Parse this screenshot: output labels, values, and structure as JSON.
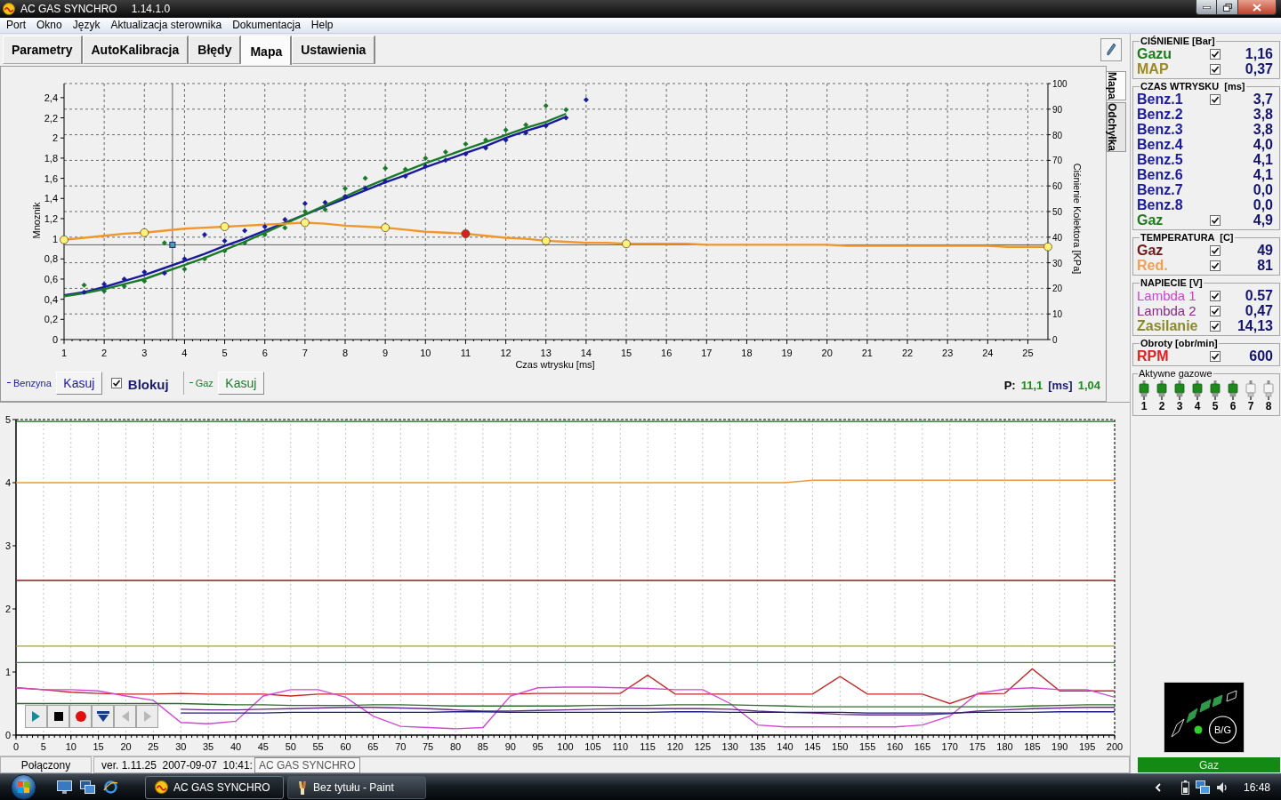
{
  "window": {
    "title": "AC GAS SYNCHRO",
    "version": "1.14.1.0"
  },
  "menu": [
    "Port",
    "Okno",
    "Język",
    "Aktualizacja sterownika",
    "Dokumentacja",
    "Help"
  ],
  "tabs": [
    {
      "label": "Parametry",
      "selected": false
    },
    {
      "label": "AutoKalibracja",
      "selected": false
    },
    {
      "label": "Błędy",
      "selected": false
    },
    {
      "label": "Mapa",
      "selected": true
    },
    {
      "label": "Ustawienia",
      "selected": false
    }
  ],
  "map_panel": {
    "side_tabs": [
      {
        "label": "Mapa",
        "selected": true
      },
      {
        "label": "Odchyłka",
        "selected": false
      }
    ],
    "chart_data": {
      "type": "line",
      "xlabel": "Czas wtrysku [ms]",
      "ylabel": "Mnoznik",
      "grid": true,
      "x": [
        1,
        1.5,
        2,
        2.5,
        3,
        3.5,
        4,
        4.5,
        5,
        5.5,
        6,
        6.5,
        7,
        7.5,
        8,
        8.5,
        9,
        9.5,
        10,
        10.5,
        11,
        11.5,
        12,
        12.5,
        13,
        13.5,
        14,
        14.5,
        15,
        15.5,
        16,
        16.5,
        17,
        17.5,
        18,
        18.5,
        19,
        19.5,
        20,
        20.5,
        21,
        21.5,
        22,
        22.5,
        23,
        23.5,
        24,
        24.5,
        25,
        25.5
      ],
      "series": [
        {
          "type": "scatter",
          "color": "#1a1a9a",
          "marker": "diamond",
          "values": [
            null,
            0.47,
            0.55,
            0.6,
            0.67,
            0.66,
            0.8,
            1.04,
            0.98,
            1.08,
            1.12,
            1.19,
            1.35,
            1.36,
            1.42,
            1.5,
            1.57,
            1.62,
            1.72,
            1.78,
            1.84,
            1.9,
            1.98,
            2.05,
            2.12,
            2.2,
            2.38,
            null,
            null,
            null,
            null,
            null,
            null,
            null,
            null,
            null,
            null,
            null,
            null,
            null,
            null,
            null,
            null,
            null,
            null,
            null,
            null,
            null,
            null,
            null
          ]
        },
        {
          "type": "scatter",
          "color": "#1a7a2a",
          "marker": "diamond",
          "values": [
            null,
            0.54,
            0.48,
            0.53,
            0.58,
            0.96,
            0.7,
            0.8,
            0.88,
            0.96,
            1.04,
            1.11,
            1.27,
            1.29,
            1.5,
            1.6,
            1.7,
            1.69,
            1.8,
            1.86,
            1.94,
            1.98,
            2.08,
            2.13,
            2.32,
            2.28,
            null,
            null,
            null,
            null,
            null,
            null,
            null,
            null,
            null,
            null,
            null,
            null,
            null,
            null,
            null,
            null,
            null,
            null,
            null,
            null,
            null,
            null,
            null,
            null
          ]
        },
        {
          "name": "Benzyna",
          "color": "#1a1a9a",
          "values": [
            0.44,
            0.47,
            0.52,
            0.58,
            0.64,
            0.71,
            0.78,
            0.85,
            0.93,
            1.0,
            1.08,
            1.16,
            1.24,
            1.32,
            1.4,
            1.48,
            1.56,
            1.63,
            1.71,
            1.78,
            1.85,
            1.92,
            2.0,
            2.07,
            2.13,
            2.21,
            null,
            null,
            null,
            null,
            null,
            null,
            null,
            null,
            null,
            null,
            null,
            null,
            null,
            null,
            null,
            null,
            null,
            null,
            null,
            null,
            null,
            null,
            null,
            null
          ]
        },
        {
          "name": "Gaz",
          "color": "#1a7a2a",
          "values": [
            0.43,
            0.46,
            0.5,
            0.55,
            0.6,
            0.67,
            0.74,
            0.81,
            0.89,
            0.97,
            1.06,
            1.15,
            1.24,
            1.33,
            1.42,
            1.51,
            1.59,
            1.67,
            1.75,
            1.82,
            1.89,
            1.96,
            2.03,
            2.1,
            2.16,
            2.24,
            null,
            null,
            null,
            null,
            null,
            null,
            null,
            null,
            null,
            null,
            null,
            null,
            null,
            null,
            null,
            null,
            null,
            null,
            null,
            null,
            null,
            null,
            null,
            null
          ]
        },
        {
          "color": "#f0962a",
          "values": [
            0.99,
            1.01,
            1.03,
            1.05,
            1.06,
            1.08,
            1.1,
            1.11,
            1.12,
            1.13,
            1.14,
            1.15,
            1.16,
            1.15,
            1.13,
            1.12,
            1.11,
            1.09,
            1.07,
            1.06,
            1.05,
            1.03,
            1.01,
            1.0,
            0.98,
            0.97,
            0.96,
            0.96,
            0.95,
            0.95,
            0.95,
            0.95,
            0.94,
            0.94,
            0.94,
            0.94,
            0.94,
            0.94,
            0.94,
            0.93,
            0.93,
            0.93,
            0.93,
            0.93,
            0.93,
            0.93,
            0.93,
            0.92,
            0.92,
            0.92
          ]
        },
        {
          "type": "scatter",
          "color": "#fff27a",
          "marker": "circle",
          "values": [
            0.99,
            null,
            null,
            null,
            1.06,
            null,
            null,
            null,
            1.12,
            null,
            null,
            null,
            1.16,
            null,
            null,
            null,
            1.11,
            null,
            null,
            null,
            null,
            null,
            null,
            null,
            0.98,
            null,
            null,
            null,
            0.95,
            null,
            null,
            null,
            null,
            null,
            null,
            null,
            null,
            null,
            null,
            null,
            null,
            null,
            null,
            null,
            null,
            null,
            null,
            null,
            null,
            0.92
          ]
        },
        {
          "type": "scatter",
          "color": "#d42020",
          "marker": "circle",
          "values": [
            null,
            null,
            null,
            null,
            null,
            null,
            null,
            null,
            null,
            null,
            null,
            null,
            null,
            null,
            null,
            null,
            null,
            null,
            null,
            null,
            1.05,
            null,
            null,
            null,
            null,
            null,
            null,
            null,
            null,
            null,
            null,
            null,
            null,
            null,
            null,
            null,
            null,
            null,
            null,
            null,
            null,
            null,
            null,
            null,
            null,
            null,
            null,
            null,
            null,
            null
          ]
        }
      ],
      "xlim": [
        1,
        25.5
      ],
      "ylim": [
        0,
        2.54
      ],
      "xticks": [
        1,
        2,
        3,
        4,
        5,
        6,
        7,
        8,
        9,
        10,
        11,
        12,
        13,
        14,
        15,
        16,
        17,
        18,
        19,
        20,
        21,
        22,
        23,
        24,
        25
      ],
      "yticks": [
        0,
        {
          "value": 0.2,
          "label": "0,2"
        },
        {
          "value": 0.4,
          "label": "0,4"
        },
        {
          "value": 0.6,
          "label": "0,6"
        },
        {
          "value": 0.8,
          "label": "0,8"
        },
        1,
        {
          "value": 1.2,
          "label": "1,2"
        },
        {
          "value": 1.4,
          "label": "1,4"
        },
        {
          "value": 1.6,
          "label": "1,6"
        },
        {
          "value": 1.8,
          "label": "1,8"
        },
        2,
        {
          "value": 2.2,
          "label": "2,2"
        },
        {
          "value": 2.4,
          "label": "2,4"
        }
      ],
      "ref_lines": [
        {
          "axis": "x",
          "value": 3.7
        },
        {
          "axis": "y",
          "value": 0.94
        }
      ]
    },
    "secondary_axis": {
      "label": "Ciśnienie Kolektora [KPa]",
      "ticks": [
        "100",
        "90",
        "80",
        "70",
        "60",
        "50",
        "40",
        "30",
        "20",
        "10",
        "0"
      ]
    },
    "clear_buttons": [
      "Kasuj",
      "Kasuj"
    ],
    "lock": {
      "label": "Blokuj",
      "checked": true
    },
    "readout": {
      "prefix": "P:",
      "time": "11,1",
      "unit": "[ms]",
      "value": "1,04"
    }
  },
  "trend_panel": {
    "chart_data": {
      "type": "line",
      "grid": true,
      "x": [
        0,
        5,
        10,
        15,
        20,
        25,
        30,
        35,
        40,
        45,
        50,
        55,
        60,
        65,
        70,
        75,
        80,
        85,
        90,
        95,
        100,
        105,
        110,
        115,
        120,
        125,
        130,
        135,
        140,
        145,
        150,
        155,
        160,
        165,
        170,
        175,
        180,
        185,
        190,
        195,
        200
      ],
      "series": [
        {
          "color": "#0b6b0b",
          "values": [
            4.97,
            4.97,
            4.97,
            4.97,
            4.97,
            4.97,
            4.97,
            4.97,
            4.97,
            4.97,
            4.97,
            4.97,
            4.97,
            4.97,
            4.97,
            4.97,
            4.97,
            4.97,
            4.97,
            4.97,
            4.97,
            4.97,
            4.97,
            4.97,
            4.97,
            4.97,
            4.97,
            4.97,
            4.97,
            4.97,
            4.97,
            4.97,
            4.97,
            4.97,
            4.97,
            4.97,
            4.97,
            4.97,
            4.97,
            4.97,
            4.97
          ]
        },
        {
          "color": "#e89a3c",
          "values": [
            4.0,
            4.0,
            4.0,
            4.0,
            4.0,
            4.0,
            4.0,
            4.0,
            4.0,
            4.0,
            4.0,
            4.0,
            4.0,
            4.0,
            4.0,
            4.0,
            4.0,
            4.0,
            4.0,
            4.0,
            4.0,
            4.0,
            4.0,
            4.0,
            4.0,
            4.0,
            4.0,
            4.0,
            4.0,
            4.04,
            4.04,
            4.04,
            4.04,
            4.04,
            4.04,
            4.04,
            4.04,
            4.04,
            4.04,
            4.04,
            4.04
          ]
        },
        {
          "color": "#8b1c1c",
          "values": [
            2.45,
            2.45,
            2.45,
            2.45,
            2.45,
            2.45,
            2.45,
            2.45,
            2.45,
            2.45,
            2.45,
            2.45,
            2.45,
            2.45,
            2.45,
            2.45,
            2.45,
            2.45,
            2.45,
            2.45,
            2.45,
            2.45,
            2.45,
            2.45,
            2.45,
            2.45,
            2.45,
            2.45,
            2.45,
            2.45,
            2.45,
            2.45,
            2.45,
            2.45,
            2.45,
            2.45,
            2.45,
            2.45,
            2.45,
            2.45,
            2.45
          ]
        },
        {
          "color": "#a89a48",
          "values": [
            1.41,
            1.41,
            1.41,
            1.41,
            1.41,
            1.41,
            1.41,
            1.41,
            1.41,
            1.41,
            1.41,
            1.41,
            1.41,
            1.41,
            1.41,
            1.41,
            1.41,
            1.41,
            1.41,
            1.41,
            1.41,
            1.41,
            1.41,
            1.41,
            1.41,
            1.41,
            1.41,
            1.41,
            1.41,
            1.41,
            1.41,
            1.41,
            1.41,
            1.41,
            1.41,
            1.41,
            1.41,
            1.41,
            1.41,
            1.41,
            1.41
          ]
        },
        {
          "color": "#3a8a3a",
          "values": [
            1.15,
            1.15,
            1.15,
            1.15,
            1.15,
            1.15,
            1.15,
            1.15,
            1.15,
            1.15,
            1.15,
            1.15,
            1.15,
            1.15,
            1.15,
            1.15,
            1.15,
            1.15,
            1.15,
            1.15,
            1.15,
            1.15,
            1.15,
            1.15,
            1.15,
            1.15,
            1.15,
            1.15,
            1.15,
            1.15,
            1.15,
            1.15,
            1.15,
            1.15,
            1.15,
            1.15,
            1.15,
            1.15,
            1.15,
            1.15,
            1.15
          ]
        },
        {
          "color": "#c02828",
          "values": [
            0.75,
            0.72,
            0.68,
            0.66,
            0.65,
            0.65,
            0.66,
            0.65,
            0.65,
            0.65,
            0.62,
            0.65,
            0.65,
            0.65,
            0.65,
            0.65,
            0.65,
            0.65,
            0.65,
            0.66,
            0.66,
            0.66,
            0.66,
            0.95,
            0.65,
            0.65,
            0.65,
            0.65,
            0.65,
            0.65,
            0.93,
            0.65,
            0.65,
            0.65,
            0.5,
            0.65,
            0.66,
            1.05,
            0.7,
            0.7,
            0.7
          ]
        },
        {
          "color": "#d048d0",
          "values": [
            0.75,
            0.72,
            0.72,
            0.7,
            0.62,
            0.55,
            0.2,
            0.18,
            0.22,
            0.62,
            0.72,
            0.72,
            0.6,
            0.3,
            0.14,
            0.12,
            0.1,
            0.12,
            0.62,
            0.75,
            0.76,
            0.76,
            0.75,
            0.74,
            0.72,
            0.72,
            0.5,
            0.16,
            0.13,
            0.13,
            0.13,
            0.13,
            0.13,
            0.16,
            0.3,
            0.66,
            0.73,
            0.75,
            0.72,
            0.72,
            0.6
          ]
        },
        {
          "color": "#2f6b2f",
          "values": [
            0.5,
            0.5,
            0.5,
            0.5,
            0.5,
            0.5,
            0.5,
            0.49,
            0.48,
            0.48,
            0.47,
            0.47,
            0.47,
            0.48,
            0.48,
            0.47,
            0.46,
            0.46,
            0.46,
            0.46,
            0.46,
            0.47,
            0.47,
            0.47,
            0.48,
            0.48,
            0.48,
            0.47,
            0.46,
            0.45,
            0.45,
            0.45,
            0.45,
            0.45,
            0.45,
            0.45,
            0.45,
            0.46,
            0.47,
            0.48,
            0.48
          ]
        },
        {
          "color": "#6a2a8a",
          "values": [
            null,
            null,
            null,
            null,
            null,
            null,
            0.41,
            0.4,
            0.4,
            0.41,
            0.42,
            0.43,
            0.44,
            0.44,
            0.43,
            0.42,
            0.4,
            0.38,
            0.38,
            0.39,
            0.4,
            0.41,
            0.42,
            0.42,
            0.42,
            0.42,
            0.41,
            0.38,
            0.36,
            0.35,
            0.33,
            0.32,
            0.32,
            0.32,
            0.34,
            0.38,
            0.4,
            0.42,
            0.43,
            0.44,
            0.44
          ]
        },
        {
          "color": "#1c1c7c",
          "values": [
            null,
            null,
            null,
            null,
            null,
            null,
            0.35,
            0.35,
            0.35,
            0.35,
            0.36,
            0.36,
            0.36,
            0.36,
            0.36,
            0.36,
            0.37,
            0.37,
            0.36,
            0.36,
            0.36,
            0.36,
            0.36,
            0.36,
            0.37,
            0.37,
            0.36,
            0.36,
            0.36,
            0.36,
            0.36,
            0.35,
            0.35,
            0.35,
            0.35,
            0.36,
            0.36,
            0.36,
            0.37,
            0.37,
            0.37
          ]
        }
      ],
      "xlim": [
        0,
        200
      ],
      "ylim": [
        0,
        5
      ],
      "xticks": [
        0,
        5,
        10,
        15,
        20,
        25,
        30,
        35,
        40,
        45,
        50,
        55,
        60,
        65,
        70,
        75,
        80,
        85,
        90,
        95,
        100,
        105,
        110,
        115,
        120,
        125,
        130,
        135,
        140,
        145,
        150,
        155,
        160,
        165,
        170,
        175,
        180,
        185,
        190,
        195,
        200
      ],
      "yticks": [
        0,
        1,
        2,
        3,
        4,
        5
      ]
    },
    "controls": [
      {
        "kind": "play",
        "disabled": false
      },
      {
        "kind": "stop",
        "disabled": false
      },
      {
        "kind": "record",
        "disabled": false
      },
      {
        "kind": "down",
        "disabled": false
      },
      {
        "kind": "back",
        "disabled": true
      },
      {
        "kind": "forward",
        "disabled": true
      }
    ]
  },
  "status_bar": {
    "connection": "Połączony",
    "info": "ver. 1.11.25  2007-09-07  10:41:",
    "tooltip": "AC GAS SYNCHRO"
  },
  "readings": [
    {
      "title": "CIŚNIENIE [Bar]",
      "rows": [
        {
          "label": "Gazu",
          "color": "#1f7a1f",
          "checked": true,
          "value": "1,16"
        },
        {
          "label": "MAP",
          "color": "#9b8a22",
          "checked": true,
          "value": "0,37"
        }
      ]
    },
    {
      "title": "CZAS WTRYSKU  [ms]",
      "rows": [
        {
          "label": "Benz.1",
          "color": "#1a1a9c",
          "checked": true,
          "value": "3,7"
        },
        {
          "label": "Benz.2",
          "color": "#1a1a9c",
          "value": "3,8"
        },
        {
          "label": "Benz.3",
          "color": "#1a1a9c",
          "value": "3,8"
        },
        {
          "label": "Benz.4",
          "color": "#1a1a9c",
          "value": "4,0"
        },
        {
          "label": "Benz.5",
          "color": "#1a1a9c",
          "value": "4,1"
        },
        {
          "label": "Benz.6",
          "color": "#1a1a9c",
          "value": "4,1"
        },
        {
          "label": "Benz.7",
          "color": "#1a1a9c",
          "value": "0,0"
        },
        {
          "label": "Benz.8",
          "color": "#1a1a9c",
          "value": "0,0"
        },
        {
          "label": "Gaz",
          "color": "#1f7a1f",
          "checked": true,
          "value": "4,9"
        }
      ]
    },
    {
      "title": "TEMPERATURA  [C]",
      "rows": [
        {
          "label": "Gaz",
          "color": "#6e1a1a",
          "checked": true,
          "value": "49"
        },
        {
          "label": "Red.",
          "color": "#f0a050",
          "checked": true,
          "value": "81"
        }
      ]
    },
    {
      "title": "NAPIECIE [V]",
      "rows": [
        {
          "label": "Lambda 1",
          "color": "#d040d0",
          "checked": true,
          "value": "0.57",
          "light": true
        },
        {
          "label": "Lambda 2",
          "color": "#862a86",
          "checked": true,
          "value": "0,47",
          "light": true
        },
        {
          "label": "Zasilanie",
          "color": "#8a8a2a",
          "checked": true,
          "value": "14,13"
        }
      ]
    },
    {
      "title": "Obroty [obr/min]",
      "rows": [
        {
          "label": "RPM",
          "color": "#e02020",
          "checked": true,
          "value": "600"
        }
      ]
    }
  ],
  "active_injectors": {
    "title": "Aktywne gazowe",
    "items": [
      {
        "label": "1",
        "active": true
      },
      {
        "label": "2",
        "active": true
      },
      {
        "label": "3",
        "active": true
      },
      {
        "label": "4",
        "active": true
      },
      {
        "label": "5",
        "active": true
      },
      {
        "label": "6",
        "active": true
      },
      {
        "label": "7",
        "active": false
      },
      {
        "label": "8",
        "active": false
      }
    ]
  },
  "switch": {
    "label": "B/G",
    "segments": [
      {
        "on": false
      },
      {
        "on": true
      },
      {
        "on": true
      },
      {
        "on": true
      },
      {
        "on": false
      }
    ],
    "led_on": true
  },
  "fuel_mode": "Gaz",
  "taskbar": {
    "tasks": [
      {
        "label": "AC GAS SYNCHRO",
        "kind": "synchro",
        "selected": true
      },
      {
        "label": "Bez tytułu - Paint",
        "kind": "paint",
        "selected": false
      }
    ],
    "clock": "16:48"
  }
}
